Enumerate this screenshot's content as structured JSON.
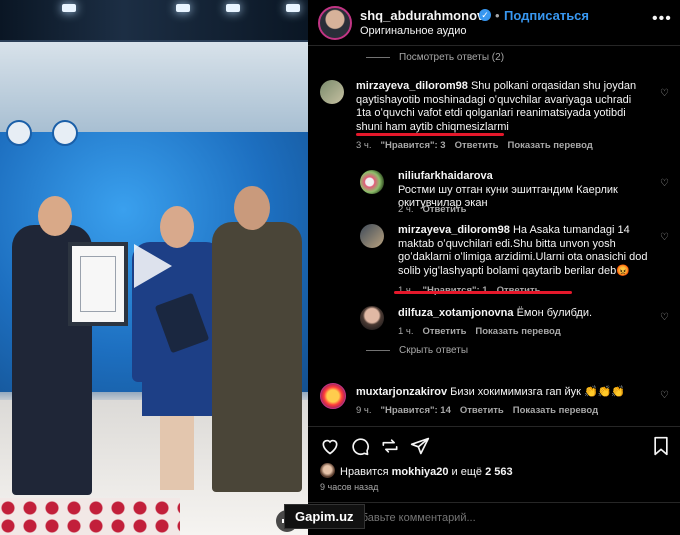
{
  "header": {
    "username": "shq_abdurahmonov",
    "follow_label": "Подписаться",
    "audio_label": "Оригинальное аудио",
    "more_icon": "more-options-icon"
  },
  "view_replies_top": "Посмотреть ответы (2)",
  "comments": [
    {
      "user": "mirzayeva_dilorom98",
      "text": "Shu polkani orqasidan shu joydan qaytishayotib moshinadagi oʻquvchilar avariyaga uchradi 1ta oʻquvchi vafot etdi qolganlari reanimatsiyada yotibdi shuni ham aytib chiqmesizlarmi",
      "time": "3 ч.",
      "likes": "\"Нравится\": 3",
      "reply": "Ответить",
      "translate": "Показать перевод"
    },
    {
      "user": "niliufarkhaidarova",
      "text": "Ростми шу отган куни эшитгандим Каерлик окитувчилар экан",
      "time": "2 ч.",
      "reply": "Ответить"
    },
    {
      "user": "mirzayeva_dilorom98",
      "text": "Ha Asaka tumandagi 14 maktab oʻquvchilari edi.Shu bitta unvon yosh goʻdaklarni oʻlimiga arzidimi.Ularni ota onasichi dod solib yigʻlashyapti bolami qaytarib berilar deb😡",
      "time": "1 ч.",
      "likes": "\"Нравится\": 1",
      "reply": "Ответить"
    },
    {
      "user": "dilfuza_xotamjonovna",
      "text": "Ёмон булибди.",
      "time": "1 ч.",
      "reply": "Ответить",
      "translate": "Показать перевод"
    },
    {
      "user": "muxtarjonzakirov",
      "text": "Бизи хокимимизга гап йук 👏👏👏",
      "time": "9 ч.",
      "likes": "\"Нравится\": 14",
      "reply": "Ответить",
      "translate": "Показать перевод"
    }
  ],
  "hide_replies": "Скрыть ответы",
  "likes_line": {
    "prefix": "Нравится",
    "user": "mokhiya20",
    "middle": "и ещё",
    "count": "2 563"
  },
  "posted_time": "9 часов назад",
  "add_comment_placeholder": "Добавьте комментарий...",
  "watermark": "Gapim.uz",
  "colors": {
    "accent_blue": "#3897f0",
    "annotation_red": "#e5182b",
    "muted_text": "#a8a8a8"
  }
}
